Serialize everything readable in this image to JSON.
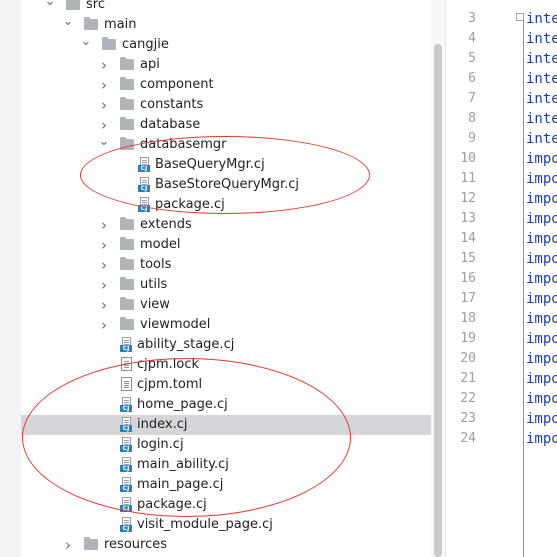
{
  "project_tree": {
    "rows": [
      {
        "label": "src",
        "kind": "folder",
        "depth": 0,
        "expanded": true
      },
      {
        "label": "main",
        "kind": "folder",
        "depth": 1,
        "expanded": true
      },
      {
        "label": "cangjie",
        "kind": "folder",
        "depth": 2,
        "expanded": true
      },
      {
        "label": "api",
        "kind": "folder",
        "depth": 3,
        "expanded": false
      },
      {
        "label": "component",
        "kind": "folder",
        "depth": 3,
        "expanded": false
      },
      {
        "label": "constants",
        "kind": "folder",
        "depth": 3,
        "expanded": false
      },
      {
        "label": "database",
        "kind": "folder",
        "depth": 3,
        "expanded": false
      },
      {
        "label": "databasemgr",
        "kind": "folder",
        "depth": 3,
        "expanded": true
      },
      {
        "label": "BaseQueryMgr.cj",
        "kind": "cj",
        "depth": 4
      },
      {
        "label": "BaseStoreQueryMgr.cj",
        "kind": "cj",
        "depth": 4
      },
      {
        "label": "package.cj",
        "kind": "cj",
        "depth": 4
      },
      {
        "label": "extends",
        "kind": "folder",
        "depth": 3,
        "expanded": false
      },
      {
        "label": "model",
        "kind": "folder",
        "depth": 3,
        "expanded": false
      },
      {
        "label": "tools",
        "kind": "folder",
        "depth": 3,
        "expanded": false
      },
      {
        "label": "utils",
        "kind": "folder",
        "depth": 3,
        "expanded": false
      },
      {
        "label": "view",
        "kind": "folder",
        "depth": 3,
        "expanded": false
      },
      {
        "label": "viewmodel",
        "kind": "folder",
        "depth": 3,
        "expanded": false
      },
      {
        "label": "ability_stage.cj",
        "kind": "cj",
        "depth": 3
      },
      {
        "label": "cjpm.lock",
        "kind": "text",
        "depth": 3
      },
      {
        "label": "cjpm.toml",
        "kind": "text",
        "depth": 3
      },
      {
        "label": "home_page.cj",
        "kind": "cj",
        "depth": 3
      },
      {
        "label": "index.cj",
        "kind": "cj",
        "depth": 3,
        "selected": true
      },
      {
        "label": "login.cj",
        "kind": "cj",
        "depth": 3
      },
      {
        "label": "main_ability.cj",
        "kind": "cj",
        "depth": 3
      },
      {
        "label": "main_page.cj",
        "kind": "cj",
        "depth": 3
      },
      {
        "label": "package.cj",
        "kind": "cj",
        "depth": 3
      },
      {
        "label": "visit_module_page.cj",
        "kind": "cj",
        "depth": 3
      },
      {
        "label": "resources",
        "kind": "folder",
        "depth": 1,
        "expanded": false
      }
    ]
  },
  "editor": {
    "lines": [
      {
        "num": "3",
        "code": "inte"
      },
      {
        "num": "4",
        "code": "inte"
      },
      {
        "num": "5",
        "code": "inte"
      },
      {
        "num": "6",
        "code": "inte"
      },
      {
        "num": "7",
        "code": "inte"
      },
      {
        "num": "8",
        "code": "inte"
      },
      {
        "num": "9",
        "code": "inte"
      },
      {
        "num": "10",
        "code": "impo"
      },
      {
        "num": "11",
        "code": "impo"
      },
      {
        "num": "12",
        "code": "impo"
      },
      {
        "num": "13",
        "code": "impo"
      },
      {
        "num": "14",
        "code": "impo"
      },
      {
        "num": "15",
        "code": "impo"
      },
      {
        "num": "16",
        "code": "impo"
      },
      {
        "num": "17",
        "code": "impo"
      },
      {
        "num": "18",
        "code": "impo"
      },
      {
        "num": "19",
        "code": "impo"
      },
      {
        "num": "20",
        "code": "impo"
      },
      {
        "num": "21",
        "code": "impo"
      },
      {
        "num": "22",
        "code": "impo"
      },
      {
        "num": "23",
        "code": "impo"
      },
      {
        "num": "24",
        "code": "impo"
      }
    ]
  },
  "colors": {
    "selection": "#d5d6d9",
    "annotation_red": "#e23b2e",
    "keyword_blue": "#1f3fb0",
    "folder_gray": "#b0b4b9",
    "cj_badge": "#2c7fb8"
  }
}
